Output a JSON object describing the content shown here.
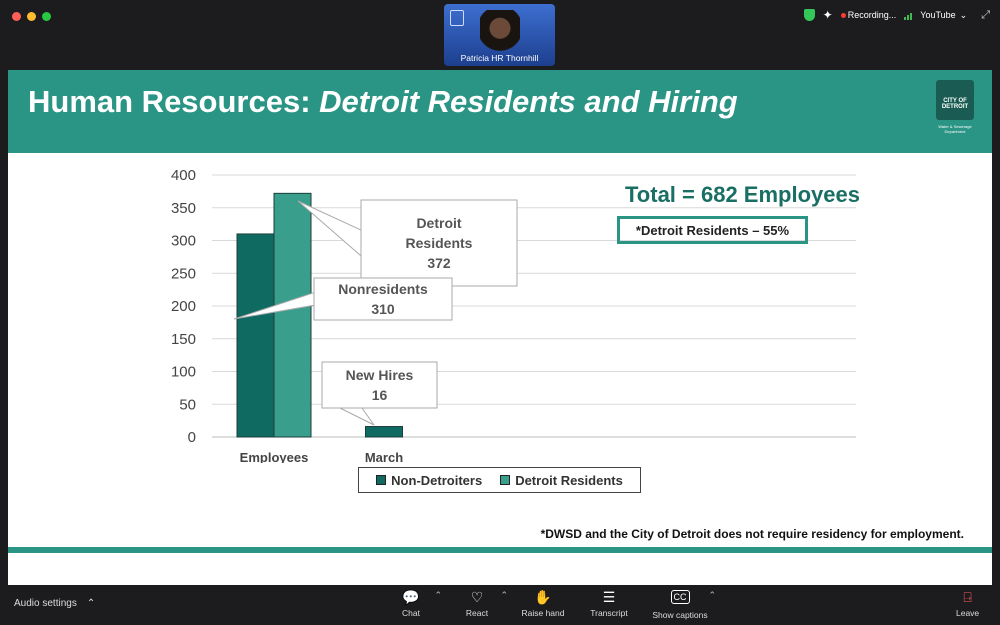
{
  "window": {
    "title": ""
  },
  "participant": {
    "name": "Patricia HR Thornhill"
  },
  "top_bar": {
    "recording_label": "Recording...",
    "app_label": "YouTube"
  },
  "slide": {
    "title_plain": "Human Resources: ",
    "title_italic": "Detroit Residents and Hiring",
    "logo_text": "CITY OF DETROIT",
    "logo_sub": "Water & Sewerage Department",
    "total_label": "Total = 682 Employees",
    "residents_label": "*Detroit Residents – 55%",
    "footnote": "*DWSD and the City of Detroit does not require residency for employment."
  },
  "chart_data": {
    "type": "bar",
    "categories": [
      "Employees",
      "March"
    ],
    "series": [
      {
        "name": "Non-Detroiters",
        "values": [
          310,
          16
        ],
        "color": "#0f6a62"
      },
      {
        "name": "Detroit Residents",
        "values": [
          372,
          null
        ],
        "color": "#3a9e8d"
      }
    ],
    "yticks": [
      0,
      50,
      100,
      150,
      200,
      250,
      300,
      350,
      400
    ],
    "ylim": [
      0,
      400
    ],
    "grid": true,
    "legend_position": "bottom",
    "callouts": [
      {
        "lines": [
          "Detroit",
          "Residents",
          "372"
        ],
        "series": 1,
        "category": 0
      },
      {
        "lines": [
          "Nonresidents",
          "310"
        ],
        "series": 0,
        "category": 0
      },
      {
        "lines": [
          "New Hires",
          "16"
        ],
        "series": 0,
        "category": 1
      }
    ]
  },
  "toolbar": {
    "audio_label": "Audio settings",
    "chat": "Chat",
    "react": "React",
    "raise_hand": "Raise hand",
    "transcript": "Transcript",
    "captions": "Show captions",
    "leave": "Leave"
  }
}
